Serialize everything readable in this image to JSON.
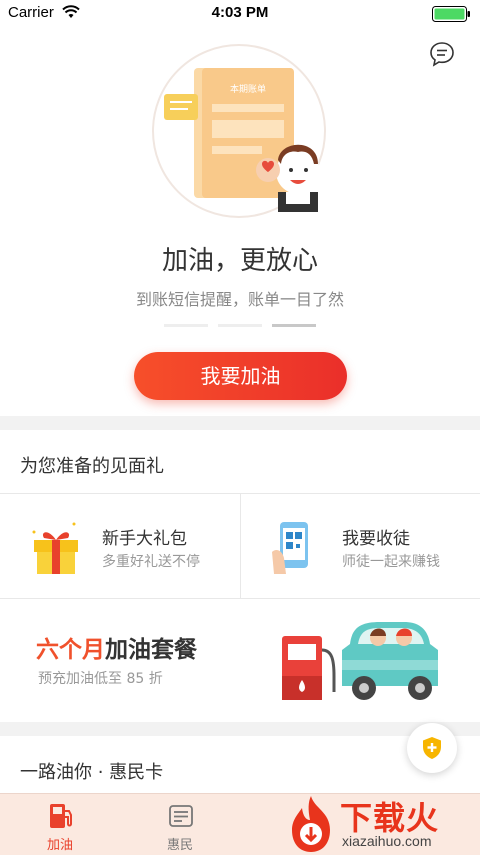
{
  "status_bar": {
    "carrier": "Carrier",
    "time": "4:03 PM"
  },
  "hero": {
    "bill_label": "本期账单",
    "headline": "加油，更放心",
    "subline": "到账短信提醒，账单一目了然",
    "carousel_active_index": 2,
    "cta_label": "我要加油"
  },
  "gifts": {
    "title": "为您准备的见面礼",
    "items": [
      {
        "title": "新手大礼包",
        "subtitle": "多重好礼送不停",
        "icon": "gift-box-icon"
      },
      {
        "title": "我要收徒",
        "subtitle": "师徒一起来赚钱",
        "icon": "phone-qr-icon"
      }
    ],
    "promo": {
      "title_highlight": "六个月",
      "title_rest": "加油套餐",
      "subtitle": "预充加油低至 85 折"
    }
  },
  "card_section": {
    "title": "一路油你 · 惠民卡"
  },
  "tabbar": {
    "tabs": [
      {
        "label": "加油",
        "icon": "fuel-pump-icon",
        "active": true
      },
      {
        "label": "惠民",
        "icon": "card-icon",
        "active": false
      }
    ]
  },
  "watermark": {
    "text": "下载火",
    "url": "xiazaihuo.com"
  },
  "colors": {
    "accent": "#ea3a2a",
    "orange": "#f0512c",
    "text": "#333333",
    "muted": "#999999"
  }
}
